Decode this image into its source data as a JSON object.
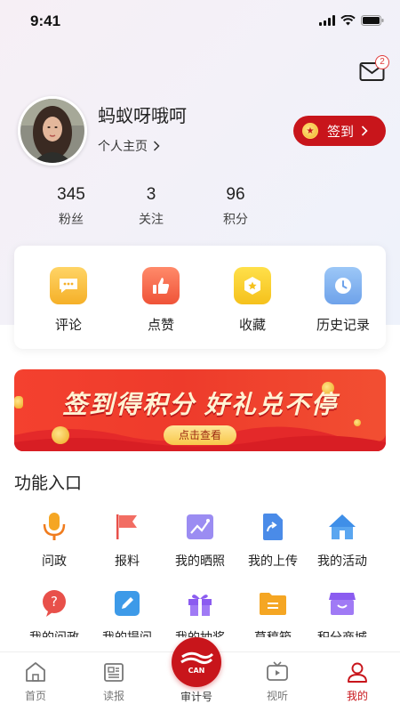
{
  "status": {
    "time": "9:41"
  },
  "profile": {
    "username": "蚂蚁呀哦呵",
    "homepage_label": "个人主页",
    "checkin_label": "签到",
    "mail_badge": "2"
  },
  "stats": [
    {
      "value": "345",
      "label": "粉丝"
    },
    {
      "value": "3",
      "label": "关注"
    },
    {
      "value": "96",
      "label": "积分"
    }
  ],
  "actions": [
    {
      "label": "评论",
      "icon": "comment-icon",
      "color": "#f5b731"
    },
    {
      "label": "点赞",
      "icon": "thumbs-up-icon",
      "color": "#f2664a"
    },
    {
      "label": "收藏",
      "icon": "star-collect-icon",
      "color": "#f7cf2a"
    },
    {
      "label": "历史记录",
      "icon": "clock-icon",
      "color": "#7fb1ef"
    }
  ],
  "banner": {
    "title": "签到得积分 好礼兑不停",
    "button": "点击查看"
  },
  "section": {
    "title": "功能入口"
  },
  "features": [
    {
      "label": "问政",
      "icon": "microphone-icon"
    },
    {
      "label": "报料",
      "icon": "flag-icon"
    },
    {
      "label": "我的晒照",
      "icon": "photo-icon"
    },
    {
      "label": "我的上传",
      "icon": "upload-file-icon"
    },
    {
      "label": "我的活动",
      "icon": "tent-icon"
    },
    {
      "label": "我的问政",
      "icon": "question-icon"
    },
    {
      "label": "我的提问",
      "icon": "edit-icon"
    },
    {
      "label": "我的抽奖",
      "icon": "gift-icon"
    },
    {
      "label": "草稿箱",
      "icon": "folder-icon"
    },
    {
      "label": "积分商城",
      "icon": "store-icon"
    }
  ],
  "tabs": [
    {
      "label": "首页",
      "icon": "home-icon"
    },
    {
      "label": "读报",
      "icon": "newspaper-icon"
    },
    {
      "label": "审计号",
      "icon": "can-logo-icon"
    },
    {
      "label": "视听",
      "icon": "tv-icon"
    },
    {
      "label": "我的",
      "icon": "user-icon"
    }
  ],
  "colors": {
    "accent": "#c8151b",
    "banner": "#f0402e"
  }
}
